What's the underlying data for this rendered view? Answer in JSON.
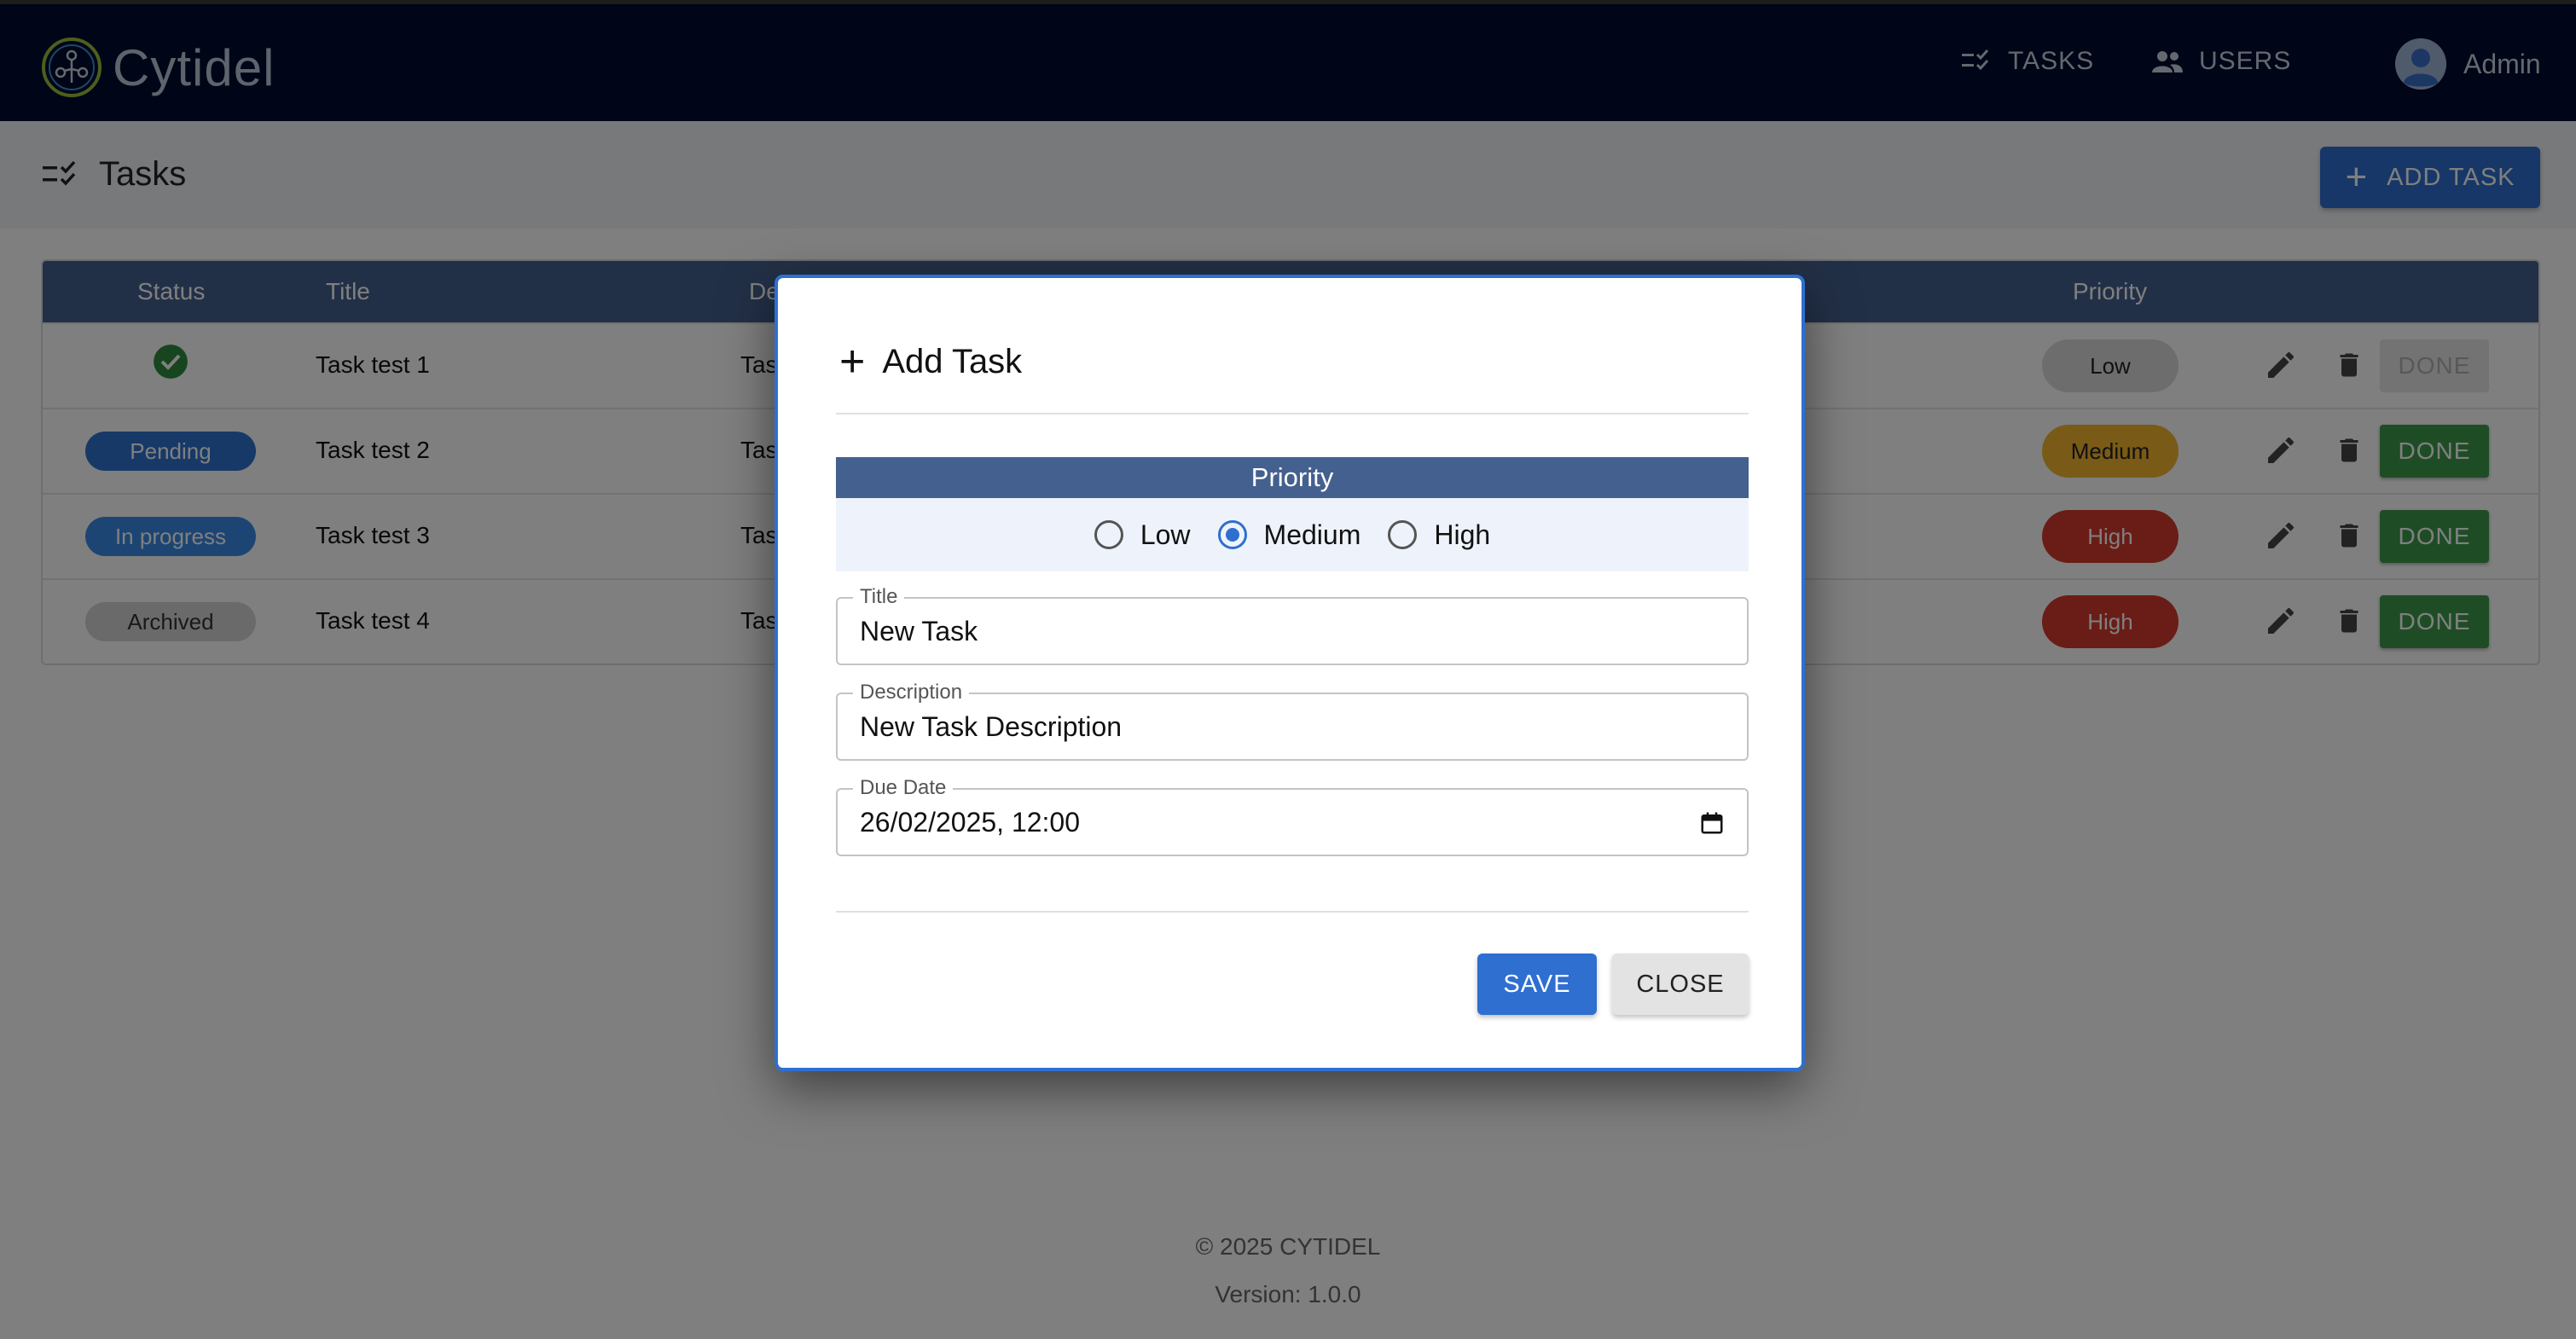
{
  "app": {
    "name": "Cytidel"
  },
  "nav": {
    "tasks": "TASKS",
    "users": "USERS",
    "user_name": "Admin"
  },
  "page": {
    "title": "Tasks",
    "add_button": "ADD TASK"
  },
  "table": {
    "headers": {
      "status": "Status",
      "title": "Title",
      "description_partial": "De",
      "priority": "Priority"
    },
    "rows": [
      {
        "status": "",
        "status_icon": "check-circle-icon",
        "title": "Task test 1",
        "description_partial": "Tas",
        "priority": "Low",
        "action": "DONE",
        "action_enabled": false
      },
      {
        "status": "Pending",
        "title": "Task test 2",
        "description_partial": "Tas",
        "priority": "Medium",
        "action": "DONE",
        "action_enabled": true
      },
      {
        "status": "In progress",
        "title": "Task test 3",
        "description_partial": "Tas",
        "priority": "High",
        "action": "DONE",
        "action_enabled": true
      },
      {
        "status": "Archived",
        "title": "Task test 4",
        "description_partial": "Tas",
        "priority": "High",
        "action": "DONE",
        "action_enabled": true
      }
    ]
  },
  "footer": {
    "copyright": "© 2025 CYTIDEL",
    "version": "Version: 1.0.0"
  },
  "dialog": {
    "title": "Add Task",
    "priority_header": "Priority",
    "priority_options": [
      "Low",
      "Medium",
      "High"
    ],
    "priority_selected": "Medium",
    "fields": {
      "title": {
        "label": "Title",
        "value": "New Task"
      },
      "description": {
        "label": "Description",
        "value": "New Task Description"
      },
      "due_date": {
        "label": "Due Date",
        "value": "26/02/2025, 12:00"
      }
    },
    "save_label": "SAVE",
    "close_label": "CLOSE"
  },
  "colors": {
    "navbar": "#000a2e",
    "primary": "#2e6fd0",
    "table_header": "#44608e",
    "success": "#3d9a4a",
    "warning": "#f2b52e",
    "danger": "#d33b2c"
  }
}
